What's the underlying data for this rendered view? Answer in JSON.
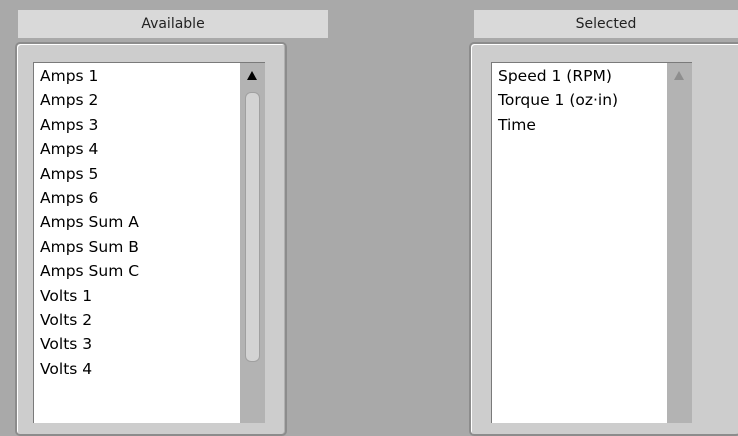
{
  "available": {
    "header": "Available",
    "items": [
      "Amps 1",
      "Amps 2",
      "Amps 3",
      "Amps 4",
      "Amps 5",
      "Amps 6",
      "Amps Sum A",
      "Amps Sum B",
      "Amps Sum C",
      "Volts 1",
      "Volts 2",
      "Volts 3",
      "Volts 4"
    ]
  },
  "selected": {
    "header": "Selected",
    "items": [
      "Speed 1 (RPM)",
      "Torque 1 (oz·in)",
      "Time"
    ]
  },
  "icons": {
    "scroll_up": "scroll-up-arrow-icon"
  },
  "colors": {
    "background": "#a9a9a9",
    "header": "#d9d9d9",
    "list": "#ffffff",
    "scrollbar": "#b3b3b3"
  }
}
